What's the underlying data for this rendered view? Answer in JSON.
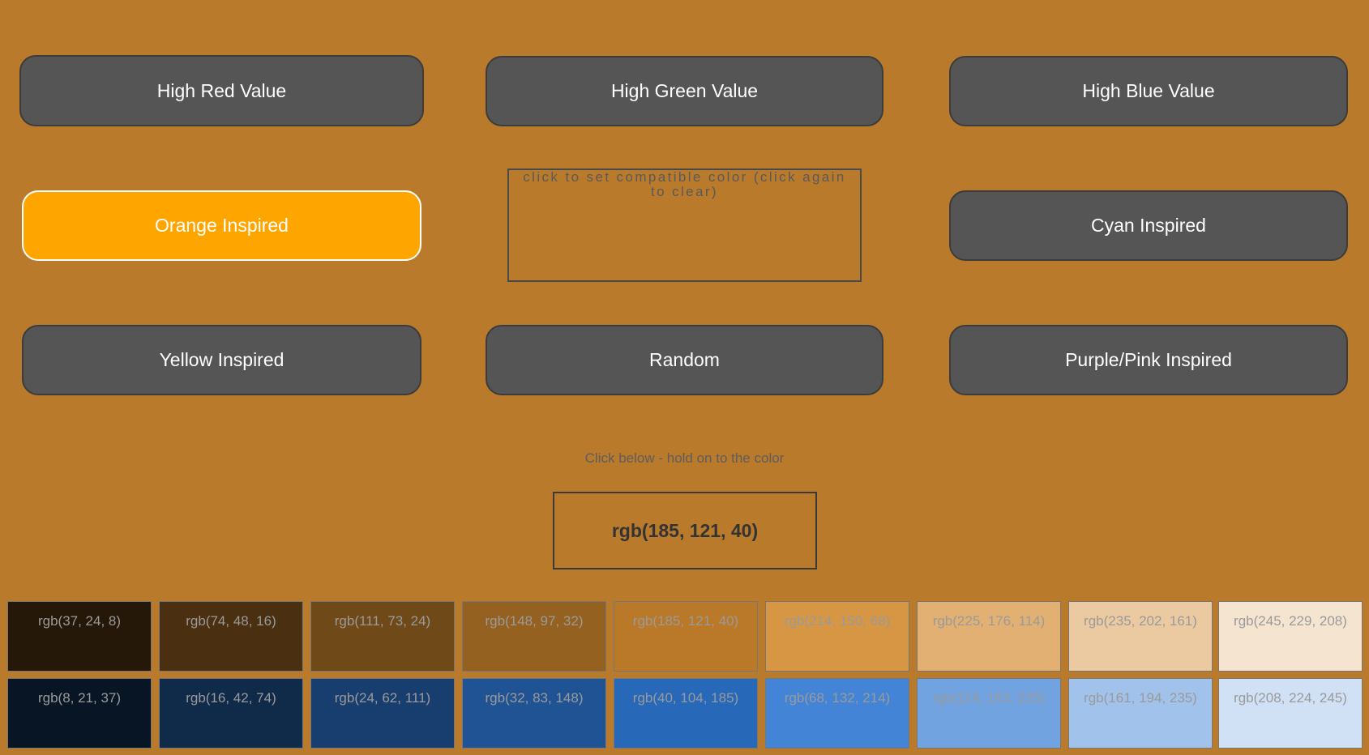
{
  "buttons": {
    "high_red": "High Red Value",
    "high_green": "High Green Value",
    "high_blue": "High Blue Value",
    "orange": "Orange Inspired",
    "cyan": "Cyan Inspired",
    "yellow": "Yellow Inspired",
    "random": "Random",
    "purple_pink": "Purple/Pink Inspired"
  },
  "active_button": "Orange Inspired",
  "compatible_box": {
    "text": "click to set compatible color (click again to clear)"
  },
  "hint": "Click below - hold on to the color",
  "current_color": {
    "label": "rgb(185, 121, 40)",
    "value": "#b97928"
  },
  "colors": {
    "page_background": "#b97a2b",
    "button_background": "#555555",
    "active_button_background": "#ffa500"
  },
  "swatches": {
    "row1": [
      {
        "label": "rgb(37, 24, 8)",
        "color": "rgb(37, 24, 8)"
      },
      {
        "label": "rgb(74, 48, 16)",
        "color": "rgb(74, 48, 16)"
      },
      {
        "label": "rgb(111, 73, 24)",
        "color": "rgb(111, 73, 24)"
      },
      {
        "label": "rgb(148, 97, 32)",
        "color": "rgb(148, 97, 32)"
      },
      {
        "label": "rgb(185, 121, 40)",
        "color": "rgb(185, 121, 40)"
      },
      {
        "label": "rgb(214, 150, 68)",
        "color": "rgb(214, 150, 68)"
      },
      {
        "label": "rgb(225, 176, 114)",
        "color": "rgb(225, 176, 114)"
      },
      {
        "label": "rgb(235, 202, 161)",
        "color": "rgb(235, 202, 161)"
      },
      {
        "label": "rgb(245, 229, 208)",
        "color": "rgb(245, 229, 208)"
      }
    ],
    "row2": [
      {
        "label": "rgb(8, 21, 37)",
        "color": "rgb(8, 21, 37)"
      },
      {
        "label": "rgb(16, 42, 74)",
        "color": "rgb(16, 42, 74)"
      },
      {
        "label": "rgb(24, 62, 111)",
        "color": "rgb(24, 62, 111)"
      },
      {
        "label": "rgb(32, 83, 148)",
        "color": "rgb(32, 83, 148)"
      },
      {
        "label": "rgb(40, 104, 185)",
        "color": "rgb(40, 104, 185)"
      },
      {
        "label": "rgb(68, 132, 214)",
        "color": "rgb(68, 132, 214)"
      },
      {
        "label": "rgb(114, 163, 225)",
        "color": "rgb(114, 163, 225)"
      },
      {
        "label": "rgb(161, 194, 235)",
        "color": "rgb(161, 194, 235)"
      },
      {
        "label": "rgb(208, 224, 245)",
        "color": "rgb(208, 224, 245)"
      }
    ]
  }
}
